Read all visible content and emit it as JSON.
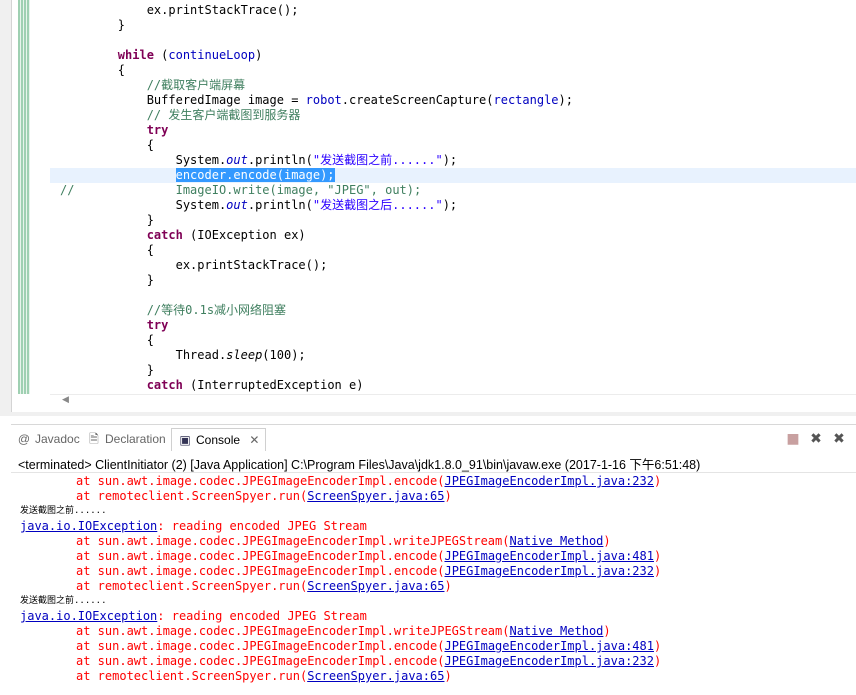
{
  "editor": {
    "lines": [
      {
        "indent": "            ",
        "parts": [
          {
            "t": "ex.printStackTrace();",
            "c": ""
          }
        ]
      },
      {
        "indent": "        ",
        "parts": [
          {
            "t": "}",
            "c": ""
          }
        ]
      },
      {
        "indent": "",
        "parts": []
      },
      {
        "indent": "        ",
        "parts": [
          {
            "t": "while",
            "c": "kw"
          },
          {
            "t": " (",
            "c": ""
          },
          {
            "t": "continueLoop",
            "c": "fld"
          },
          {
            "t": ")",
            "c": ""
          }
        ]
      },
      {
        "indent": "        ",
        "parts": [
          {
            "t": "{",
            "c": ""
          }
        ]
      },
      {
        "indent": "            ",
        "parts": [
          {
            "t": "//截取客户端屏幕",
            "c": "cmt"
          }
        ]
      },
      {
        "indent": "            ",
        "parts": [
          {
            "t": "BufferedImage image = ",
            "c": ""
          },
          {
            "t": "robot",
            "c": "fld"
          },
          {
            "t": ".createScreenCapture(",
            "c": ""
          },
          {
            "t": "rectangle",
            "c": "fld"
          },
          {
            "t": ");",
            "c": ""
          }
        ]
      },
      {
        "indent": "            ",
        "parts": [
          {
            "t": "// 发生客户端截图到服务器",
            "c": "cmt"
          }
        ]
      },
      {
        "indent": "            ",
        "parts": [
          {
            "t": "try",
            "c": "kw"
          }
        ]
      },
      {
        "indent": "            ",
        "parts": [
          {
            "t": "{",
            "c": ""
          }
        ]
      },
      {
        "indent": "                ",
        "parts": [
          {
            "t": "System.",
            "c": ""
          },
          {
            "t": "out",
            "c": "it"
          },
          {
            "t": ".println(",
            "c": ""
          },
          {
            "t": "\"发送截图之前......\"",
            "c": "str"
          },
          {
            "t": ");",
            "c": ""
          }
        ]
      },
      {
        "indent": "                ",
        "cur": true,
        "parts": [
          {
            "t": "encoder.encode(image);",
            "c": "sel"
          }
        ]
      },
      {
        "indent": "//              ",
        "parts": [
          {
            "t": "ImageIO.write(image, \"JPEG\", out);",
            "c": "cmt"
          }
        ],
        "commented": true
      },
      {
        "indent": "                ",
        "parts": [
          {
            "t": "System.",
            "c": ""
          },
          {
            "t": "out",
            "c": "it"
          },
          {
            "t": ".println(",
            "c": ""
          },
          {
            "t": "\"发送截图之后......\"",
            "c": "str"
          },
          {
            "t": ");",
            "c": ""
          }
        ]
      },
      {
        "indent": "            ",
        "parts": [
          {
            "t": "}",
            "c": ""
          }
        ]
      },
      {
        "indent": "            ",
        "parts": [
          {
            "t": "catch",
            "c": "kw"
          },
          {
            "t": " (IOException ex)",
            "c": ""
          }
        ]
      },
      {
        "indent": "            ",
        "parts": [
          {
            "t": "{",
            "c": ""
          }
        ]
      },
      {
        "indent": "                ",
        "parts": [
          {
            "t": "ex.printStackTrace();",
            "c": ""
          }
        ]
      },
      {
        "indent": "            ",
        "parts": [
          {
            "t": "}",
            "c": ""
          }
        ]
      },
      {
        "indent": "",
        "parts": []
      },
      {
        "indent": "            ",
        "parts": [
          {
            "t": "//等待0.1s减小网络阻塞",
            "c": "cmt"
          }
        ]
      },
      {
        "indent": "            ",
        "parts": [
          {
            "t": "try",
            "c": "kw"
          }
        ]
      },
      {
        "indent": "            ",
        "parts": [
          {
            "t": "{",
            "c": ""
          }
        ]
      },
      {
        "indent": "                ",
        "parts": [
          {
            "t": "Thread.",
            "c": ""
          },
          {
            "t": "sleep",
            "c": "it2"
          },
          {
            "t": "(100);",
            "c": ""
          }
        ]
      },
      {
        "indent": "            ",
        "parts": [
          {
            "t": "}",
            "c": ""
          }
        ]
      },
      {
        "indent": "            ",
        "parts": [
          {
            "t": "catch",
            "c": "kw"
          },
          {
            "t": " (InterruptedException e)",
            "c": ""
          }
        ]
      }
    ]
  },
  "tabs": {
    "javadoc": "Javadoc",
    "declaration": "Declaration",
    "console": "Console"
  },
  "icons": [
    "javadoc-icon",
    "declaration-icon",
    "console-icon",
    "close-icon",
    "terminate-icon",
    "remove-launch-icon",
    "remove-all-icon"
  ],
  "status": "<terminated> ClientInitiator (2) [Java Application] C:\\Program Files\\Java\\jdk1.8.0_91\\bin\\javaw.exe (2017-1-16 下午6:51:48)",
  "console": {
    "lines": [
      {
        "type": "at",
        "pre": "at sun.awt.image.codec.JPEGImageEncoderImpl.encode(",
        "link": "JPEGImageEncoderImpl.java:232",
        "post": ")"
      },
      {
        "type": "at",
        "pre": "at remoteclient.ScreenSpyer.run(",
        "link": "ScreenSpyer.java:65",
        "post": ")"
      },
      {
        "type": "msg",
        "text": "发送截图之前......"
      },
      {
        "type": "exc",
        "link": "java.io.IOException",
        "post": ": reading encoded JPEG Stream"
      },
      {
        "type": "at",
        "pre": "at sun.awt.image.codec.JPEGImageEncoderImpl.writeJPEGStream(",
        "link": "Native Method",
        "post": ")"
      },
      {
        "type": "at",
        "pre": "at sun.awt.image.codec.JPEGImageEncoderImpl.encode(",
        "link": "JPEGImageEncoderImpl.java:481",
        "post": ")"
      },
      {
        "type": "at",
        "pre": "at sun.awt.image.codec.JPEGImageEncoderImpl.encode(",
        "link": "JPEGImageEncoderImpl.java:232",
        "post": ")"
      },
      {
        "type": "at",
        "pre": "at remoteclient.ScreenSpyer.run(",
        "link": "ScreenSpyer.java:65",
        "post": ")"
      },
      {
        "type": "msg",
        "text": "发送截图之前......"
      },
      {
        "type": "exc",
        "link": "java.io.IOException",
        "post": ": reading encoded JPEG Stream"
      },
      {
        "type": "at",
        "pre": "at sun.awt.image.codec.JPEGImageEncoderImpl.writeJPEGStream(",
        "link": "Native Method",
        "post": ")"
      },
      {
        "type": "at",
        "pre": "at sun.awt.image.codec.JPEGImageEncoderImpl.encode(",
        "link": "JPEGImageEncoderImpl.java:481",
        "post": ")"
      },
      {
        "type": "at",
        "pre": "at sun.awt.image.codec.JPEGImageEncoderImpl.encode(",
        "link": "JPEGImageEncoderImpl.java:232",
        "post": ")"
      },
      {
        "type": "at",
        "pre": "at remoteclient.ScreenSpyer.run(",
        "link": "ScreenSpyer.java:65",
        "post": ")"
      }
    ]
  }
}
